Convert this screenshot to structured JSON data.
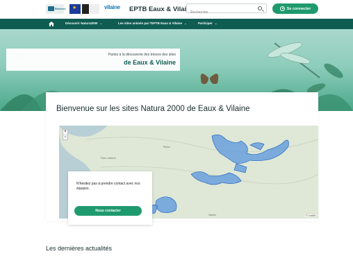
{
  "header": {
    "logo_1_text": "Rivières",
    "logo_5_text": "vilaine",
    "site_title": "EPTB Eaux & Vilaine",
    "search_placeholder": "Rechercher",
    "login_label": "Se connecter"
  },
  "nav": {
    "items": [
      {
        "label": "Découvrir Natura2000"
      },
      {
        "label": "Les sites animés par l'EPTB Eaux & Vilaine"
      },
      {
        "label": "Participer"
      }
    ],
    "chevron": "⌄"
  },
  "hero": {
    "line1": "Partez à la découverte des trésors des sites",
    "line2": "de Eaux & Vilaine"
  },
  "main": {
    "title": "Bienvenue sur les sites Natura 2000 de Eaux & Vilaine",
    "map": {
      "zoom_in": "+",
      "zoom_out": "−",
      "attribution": "© Leaflet"
    },
    "contact": {
      "text": "N'hésitez pas à prendre contact avec nos équipes.",
      "button": "Nous contacter"
    }
  },
  "news": {
    "title": "Les dernières actualités"
  },
  "colors": {
    "primary_green": "#1f9a6e",
    "nav_green": "#0f5c53",
    "map_sites": "#4a90e2"
  }
}
